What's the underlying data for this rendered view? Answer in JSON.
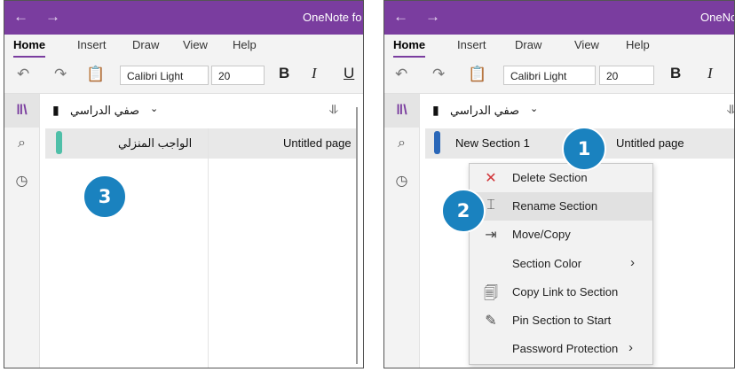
{
  "left": {
    "app_title": "OneNote fo",
    "nav_back": "←",
    "nav_forward": "→",
    "tabs": [
      "Home",
      "Insert",
      "Draw",
      "View",
      "Help"
    ],
    "font_name": "Calibri Light",
    "font_size": "20",
    "fmt": [
      "B",
      "I",
      "U"
    ],
    "notebook": "صفي الدراسي",
    "section": "الواجب المنزلي",
    "page": "Untitled page",
    "section_color": "#4fbfa8",
    "callout": "3"
  },
  "right": {
    "app_title": "OneNo",
    "nav_back": "←",
    "nav_forward": "→",
    "tabs": [
      "Home",
      "Insert",
      "Draw",
      "View",
      "Help"
    ],
    "font_name": "Calibri Light",
    "font_size": "20",
    "fmt": [
      "B",
      "I"
    ],
    "notebook": "صفي الدراسي",
    "section": "New Section 1",
    "page": "Untitled page",
    "section_color": "#2a67b8",
    "callouts": [
      "1",
      "2"
    ],
    "menu": [
      {
        "label": "Delete Section",
        "icon": "close-icon"
      },
      {
        "label": "Rename Section",
        "icon": "rename-icon"
      },
      {
        "label": "Move/Copy",
        "icon": "move-icon"
      },
      {
        "label": "Section Color",
        "icon": "",
        "arrow": "›"
      },
      {
        "label": "Copy Link to Section",
        "icon": "link-icon"
      },
      {
        "label": "Pin Section to Start",
        "icon": "pin-icon"
      },
      {
        "label": "Password Protection",
        "icon": "",
        "arrow": "›"
      }
    ]
  },
  "colors": {
    "titlebar": "#7a3d9f",
    "callout": "#1a82bf",
    "delete_icon": "#d13438"
  }
}
